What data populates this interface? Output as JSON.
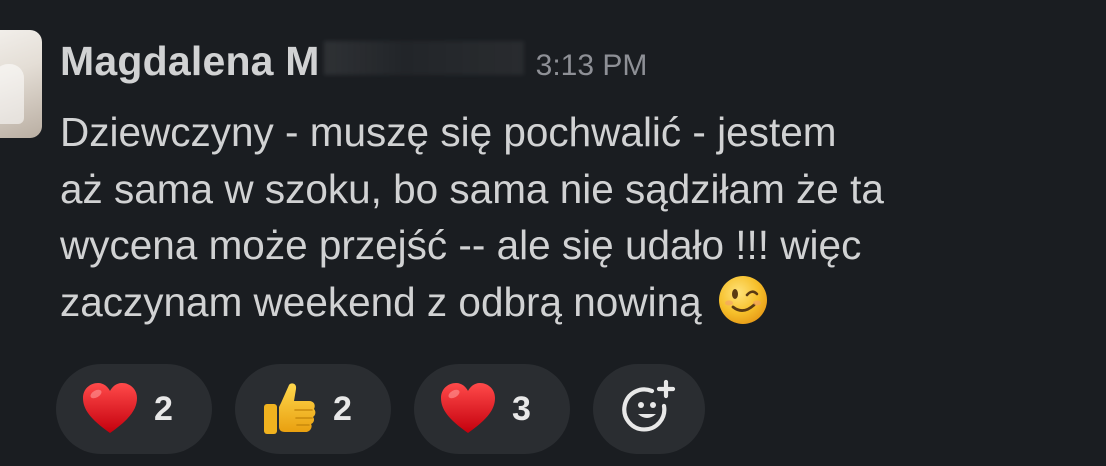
{
  "message": {
    "author": "Magdalena M",
    "timestamp": "3:13 PM",
    "lines": [
      "Dziewczyny - muszę się pochwalić - jestem",
      "aż sama w szoku, bo sama nie sądziłam że ta",
      "wycena może przejść -- ale się udało !!! więc",
      "zaczynam weekend z odbrą nowiną"
    ],
    "inline_emoji": "winking-face"
  },
  "reactions": [
    {
      "emoji": "red-heart",
      "count": "2"
    },
    {
      "emoji": "thumbs-up",
      "count": "2"
    },
    {
      "emoji": "red-heart",
      "count": "3"
    }
  ],
  "add_reaction": {
    "icon": "add-reaction-icon"
  },
  "colors": {
    "background": "#1a1d21",
    "text": "#d1d2d3",
    "timestamp": "#8e9096",
    "reaction_pill": "#2a2d31",
    "heart": "#e0131f",
    "emoji_yellow": "#f6c02b"
  }
}
